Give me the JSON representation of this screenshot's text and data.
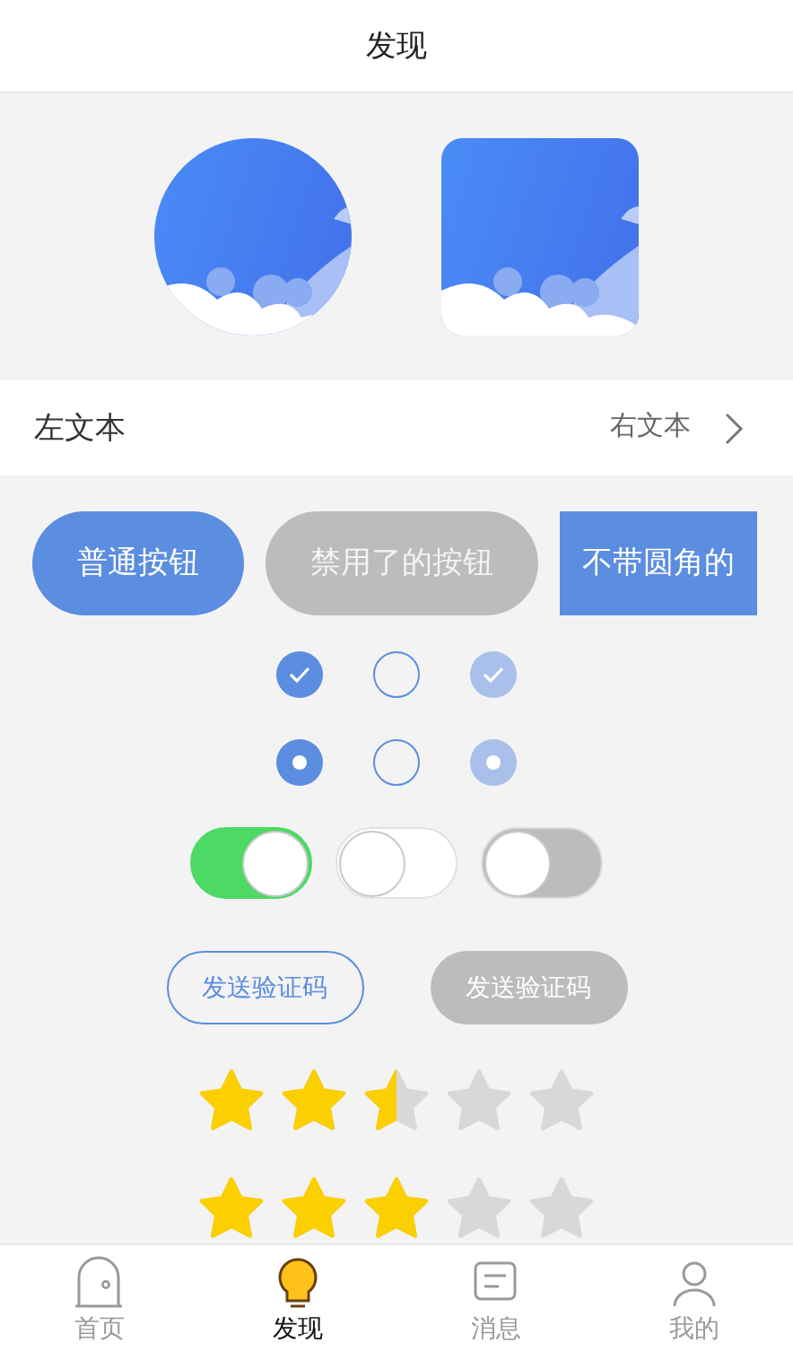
{
  "header": {
    "title": "发现"
  },
  "list_row": {
    "left": "左文本",
    "right": "右文本"
  },
  "buttons": [
    {
      "label": "普通按钮",
      "kind": "primary"
    },
    {
      "label": "禁用了的按钮",
      "kind": "disabled"
    },
    {
      "label": "不带圆角的",
      "kind": "square"
    }
  ],
  "checkboxes": [
    {
      "checked": true,
      "disabled": false
    },
    {
      "checked": false,
      "disabled": false
    },
    {
      "checked": true,
      "disabled": true
    }
  ],
  "radios": [
    {
      "selected": true,
      "disabled": false
    },
    {
      "selected": false,
      "disabled": false
    },
    {
      "selected": true,
      "disabled": true
    }
  ],
  "switches": [
    {
      "on": true,
      "disabled": false
    },
    {
      "on": false,
      "disabled": false
    },
    {
      "on": false,
      "disabled": true
    }
  ],
  "code_buttons": [
    {
      "label": "发送验证码",
      "disabled": false
    },
    {
      "label": "发送验证码",
      "disabled": true
    }
  ],
  "ratings": [
    {
      "stars": 2.5
    },
    {
      "stars": 3
    }
  ],
  "tabs": [
    {
      "label": "首页",
      "selected": false
    },
    {
      "label": "发现",
      "selected": true
    },
    {
      "label": "消息",
      "selected": false
    },
    {
      "label": "我的",
      "selected": false
    }
  ]
}
